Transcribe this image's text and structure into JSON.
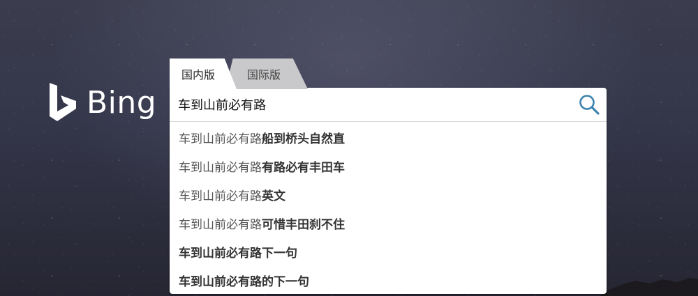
{
  "brand": {
    "logo_text": "Bing",
    "accent_color": "#3c84b0"
  },
  "tabs": [
    {
      "label": "国内版",
      "active": true
    },
    {
      "label": "国际版",
      "active": false
    }
  ],
  "search": {
    "value": "车到山前必有路",
    "button_icon": "magnifier-icon"
  },
  "suggestions": [
    {
      "prefix": "车到山前必有路 ",
      "suffix": "船到桥头自然直"
    },
    {
      "prefix": "车到山前必有路 ",
      "suffix": "有路必有丰田车"
    },
    {
      "prefix": "车到山前必有路 ",
      "suffix": "英文"
    },
    {
      "prefix": "车到山前必有路 ",
      "suffix": "可惜丰田刹不住"
    },
    {
      "prefix": "车到山前必有路下一句",
      "suffix": ""
    },
    {
      "prefix": "车到山前必有路的下一句",
      "suffix": ""
    }
  ]
}
